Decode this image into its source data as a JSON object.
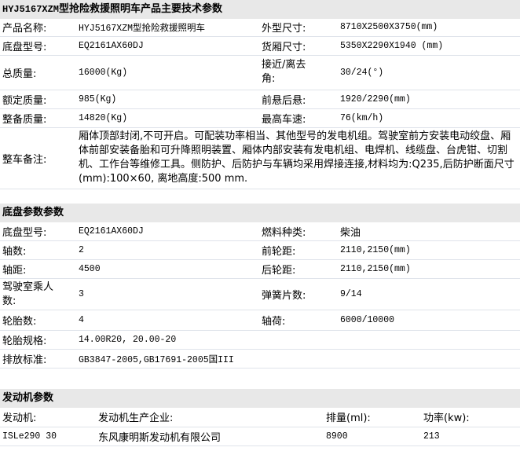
{
  "spec": {
    "title_code": "HYJ5167XZM",
    "title_text": "型抢险救援照明车产品主要技术参数",
    "rows": [
      {
        "l1": "产品名称:",
        "v1": "HYJ5167XZM型抢险救援照明车",
        "l2": "外型尺寸:",
        "v2": "8710X2500X3750(mm)"
      },
      {
        "l1": "底盘型号:",
        "v1": "EQ2161AX60DJ",
        "l2": "货厢尺寸:",
        "v2": "5350X2290X1940 (mm)"
      },
      {
        "l1": "总质量:",
        "v1": "16000(Kg)",
        "l2": "接近/离去角:",
        "v2": "30/24(°)"
      },
      {
        "l1": "额定质量:",
        "v1": "985(Kg)",
        "l2": "前悬后悬:",
        "v2": "1920/2290(mm)"
      },
      {
        "l1": "整备质量:",
        "v1": "14820(Kg)",
        "l2": "最高车速:",
        "v2": "76(km/h)"
      }
    ],
    "note_label": "整车备注:",
    "note_text": "厢体顶部封闭,不可开启。可配装功率相当、其他型号的发电机组。驾驶室前方安装电动绞盘、厢体前部安装备胎和可升降照明装置、厢体内部安装有发电机组、电焊机、线缆盘、台虎钳、切割机、工作台等维修工具。侧防护、后防护与车辆均采用焊接连接,材料均为:Q235,后防护断面尺寸(mm):100×60, 离地高度:500 mm."
  },
  "chassis": {
    "title": "底盘参数参数",
    "rows": [
      {
        "l1": "底盘型号:",
        "v1": "EQ2161AX60DJ",
        "l2": "燃料种类:",
        "v2": "柴油"
      },
      {
        "l1": "轴数:",
        "v1": "2",
        "l2": "前轮距:",
        "v2": "2110,2150(mm)"
      },
      {
        "l1": "轴距:",
        "v1": "4500",
        "l2": "后轮距:",
        "v2": "2110,2150(mm)"
      },
      {
        "l1": "驾驶室乘人数:",
        "v1": "3",
        "l2": "弹簧片数:",
        "v2": "9/14"
      },
      {
        "l1": "轮胎数:",
        "v1": "4",
        "l2": "轴荷:",
        "v2": "6000/10000"
      }
    ],
    "tire_label": "轮胎规格:",
    "tire_value": "14.00R20, 20.00-20",
    "emission_label": "排放标准:",
    "emission_value": "GB3847-2005,GB17691-2005国III"
  },
  "engine": {
    "title": "发动机参数",
    "headers": [
      "发动机:",
      "发动机生产企业:",
      "排量(ml):",
      "功率(kw):"
    ],
    "row": [
      "ISLe290 30",
      "东风康明斯发动机有限公司",
      "8900",
      "213"
    ]
  }
}
